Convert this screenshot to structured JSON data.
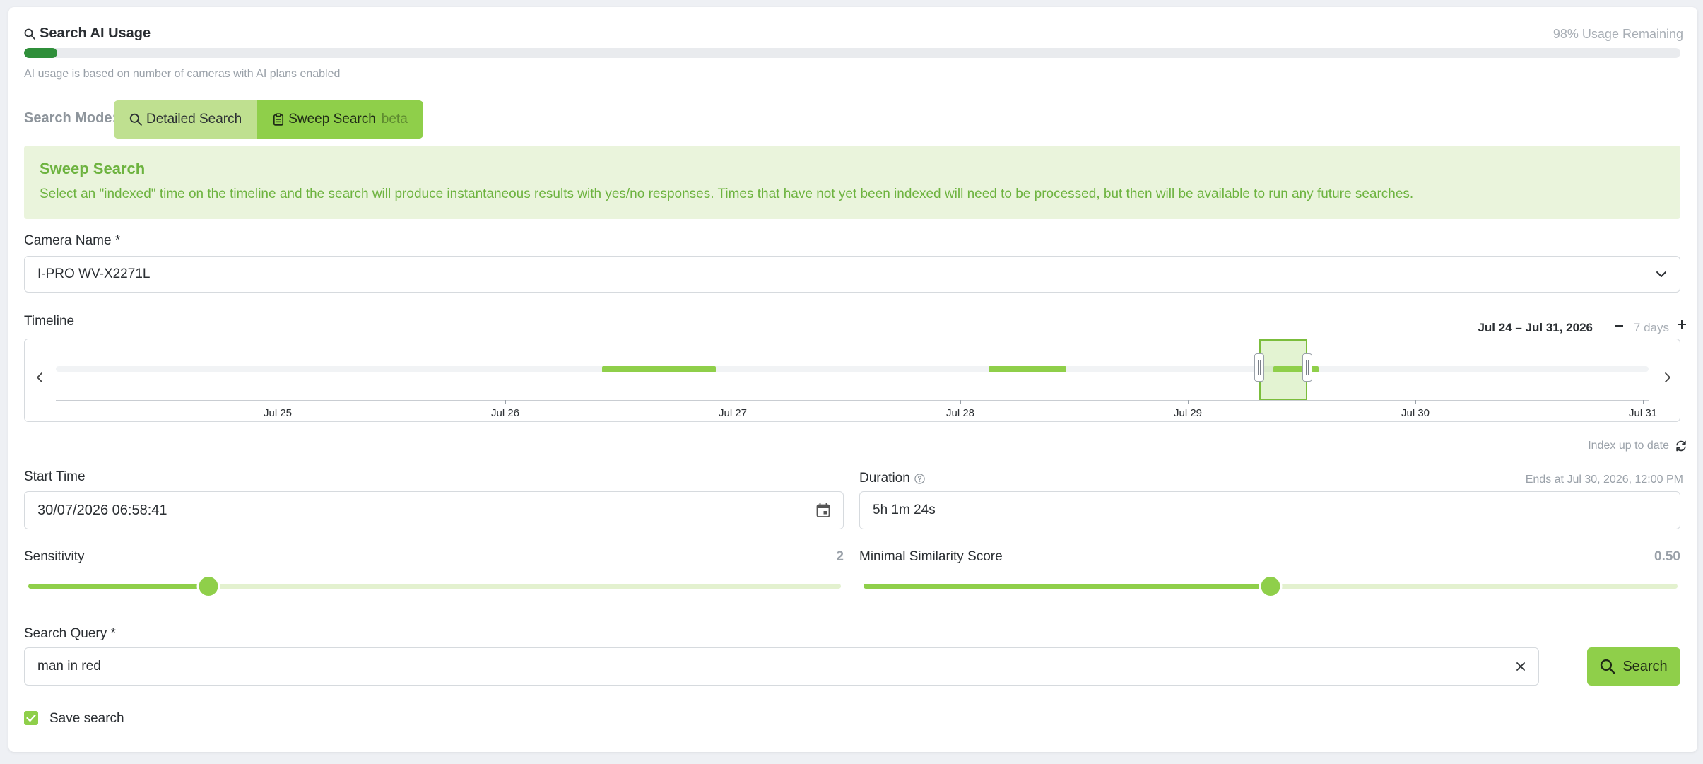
{
  "usage": {
    "title": "Search AI Usage",
    "remaining": "98% Usage Remaining",
    "used_fraction": 0.02,
    "note": "AI usage is based on number of cameras with AI plans enabled"
  },
  "search_mode": {
    "label": "Search Mode:",
    "detailed": "Detailed Search",
    "sweep": "Sweep Search",
    "sweep_badge": "beta",
    "active": "sweep"
  },
  "banner": {
    "title": "Sweep Search",
    "text": "Select an \"indexed\" time on the timeline and the search will produce instantaneous results with yes/no responses. Times that have not yet been indexed will need to be processed, but then will be available to run any future searches."
  },
  "camera": {
    "label": "Camera Name *",
    "value": "I-PRO WV-X2271L"
  },
  "timeline": {
    "label": "Timeline",
    "range": "Jul 24 – Jul 31, 2026",
    "zoom_label": "7 days",
    "ticks": [
      "Jul 25",
      "Jul 26",
      "Jul 27",
      "Jul 28",
      "Jul 29",
      "Jul 30",
      "Jul 31"
    ],
    "indexed_ranges": [
      {
        "start": 2.4,
        "end": 2.9
      },
      {
        "start": 4.1,
        "end": 4.44
      },
      {
        "start": 5.35,
        "end": 5.55
      }
    ],
    "selection": {
      "start": 5.29,
      "end": 5.5
    },
    "index_status": "Index up to date"
  },
  "start_time": {
    "label": "Start Time",
    "value": "30/07/2026 06:58:41"
  },
  "duration": {
    "label": "Duration",
    "value": "5h 1m 24s",
    "ends_at": "Ends at Jul 30, 2026, 12:00 PM"
  },
  "sensitivity": {
    "label": "Sensitivity",
    "value": "2",
    "fraction": 0.222
  },
  "similarity": {
    "label": "Minimal Similarity Score",
    "value": "0.50",
    "fraction": 0.5
  },
  "query": {
    "label": "Search Query *",
    "value": "man in red",
    "search_label": "Search"
  },
  "save_search": {
    "label": "Save search",
    "checked": true
  },
  "colors": {
    "accent": "#8fcf4a",
    "accent_light": "#eaf4dc",
    "usage_fill": "#2f8f3a"
  }
}
